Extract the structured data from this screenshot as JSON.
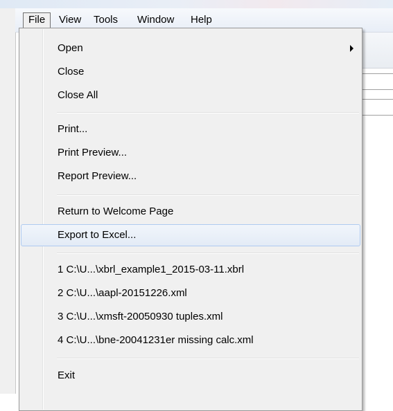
{
  "menubar": {
    "items": [
      {
        "label": "File"
      },
      {
        "label": "View"
      },
      {
        "label": "Tools"
      },
      {
        "label": "Window"
      },
      {
        "label": "Help"
      }
    ]
  },
  "file_menu": {
    "open": "Open",
    "close": "Close",
    "close_all": "Close All",
    "print": "Print...",
    "print_preview": "Print Preview...",
    "report_preview": "Report Preview...",
    "return_welcome": "Return to Welcome Page",
    "export_excel": "Export to Excel...",
    "recent": [
      "1 C:\\U...\\xbrl_example1_2015-03-11.xbrl",
      "2 C:\\U...\\aapl-20151226.xml",
      "3 C:\\U...\\xmsft-20050930 tuples.xml",
      "4 C:\\U...\\bne-20041231er missing calc.xml"
    ],
    "exit": "Exit",
    "highlighted_item": "Export to Excel...",
    "submenu_arrow_icon": "chevron-right-icon"
  },
  "colors": {
    "menu_bg": "#f0f0f0",
    "highlight_border": "#aecaf0",
    "highlight_bg": "#e3ebf6"
  }
}
